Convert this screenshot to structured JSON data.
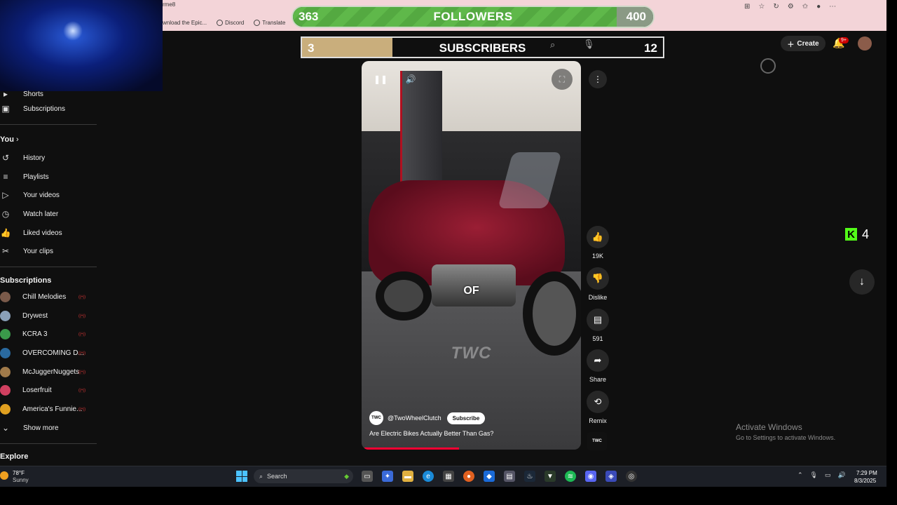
{
  "browser": {
    "address_fragment": "rme8",
    "bookmarks": [
      "wnload the Epic...",
      "Discord",
      "Translate"
    ]
  },
  "overlay": {
    "followers": {
      "current": "363",
      "title": "FOLLOWERS",
      "goal": "400",
      "progress_fraction": 0.9
    },
    "subscribers": {
      "current": "3",
      "title": "SUBSCRIBERS",
      "goal": "12",
      "progress_fraction": 0.25
    },
    "kick": {
      "count": "4",
      "logo": "K",
      "color": "#53fc18"
    }
  },
  "header": {
    "create_label": "Create",
    "notification_badge": "9+"
  },
  "sidebar": {
    "partial_item": "Shorts",
    "subscriptions_item": "Subscriptions",
    "you_heading": "You",
    "you_items": [
      "History",
      "Playlists",
      "Your videos",
      "Watch later",
      "Liked videos",
      "Your clips"
    ],
    "subscriptions_heading": "Subscriptions",
    "channels": [
      {
        "name": "Chill Melodies",
        "color": "#7a5a4a"
      },
      {
        "name": "Drywest",
        "color": "#8aa0b8"
      },
      {
        "name": "KCRA 3",
        "color": "#3a9a4a"
      },
      {
        "name": "OVERCOMING D...",
        "color": "#2a6aa0"
      },
      {
        "name": "McJuggerNuggets",
        "color": "#a07a4a"
      },
      {
        "name": "Loserfruit",
        "color": "#d04060"
      },
      {
        "name": "America's Funnie...",
        "color": "#e0a020"
      }
    ],
    "show_more": "Show more",
    "explore_heading": "Explore"
  },
  "short": {
    "caption_word": "OF",
    "watermark": "TWC",
    "channel_logo": "TWC",
    "channel_handle": "@TwoWheelClutch",
    "subscribe_label": "Subscribe",
    "title": "Are Electric Bikes Actually Better Than Gas?",
    "progress_fraction": 0.43
  },
  "actions": {
    "likes": "19K",
    "dislike": "Dislike",
    "comments": "591",
    "share": "Share",
    "remix": "Remix"
  },
  "activate": {
    "title": "Activate Windows",
    "subtitle": "Go to Settings to activate Windows."
  },
  "taskbar": {
    "temperature": "78°F",
    "condition": "Sunny",
    "search_label": "Search",
    "time": "7:29 PM",
    "date": "8/3/2025"
  }
}
